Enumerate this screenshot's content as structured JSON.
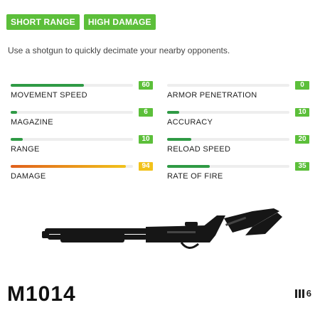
{
  "tags": [
    "SHORT RANGE",
    "HIGH DAMAGE"
  ],
  "description": "Use a shotgun to quickly decimate your nearby opponents.",
  "stats": [
    {
      "label": "MOVEMENT SPEED",
      "value": "60",
      "fill": 0.6,
      "level": "normal"
    },
    {
      "label": "ARMOR PENETRATION",
      "value": "0",
      "fill": 0.0,
      "level": "normal"
    },
    {
      "label": "MAGAZINE",
      "value": "6",
      "fill": 0.05,
      "level": "normal"
    },
    {
      "label": "ACCURACY",
      "value": "10",
      "fill": 0.1,
      "level": "normal"
    },
    {
      "label": "RANGE",
      "value": "10",
      "fill": 0.1,
      "level": "normal"
    },
    {
      "label": "RELOAD SPEED",
      "value": "20",
      "fill": 0.2,
      "level": "normal"
    },
    {
      "label": "DAMAGE",
      "value": "94",
      "fill": 0.94,
      "level": "high"
    },
    {
      "label": "RATE OF FIRE",
      "value": "35",
      "fill": 0.35,
      "level": "normal"
    }
  ],
  "weapon": {
    "name": "M1014",
    "ammo_icon": "ammo-bars-icon",
    "ammo_count": "6"
  },
  "colors": {
    "tag": "#5cbf3a",
    "bar": "#2f9a45",
    "badge": "#5cbf3a",
    "high_badge": "#f2c21b"
  }
}
